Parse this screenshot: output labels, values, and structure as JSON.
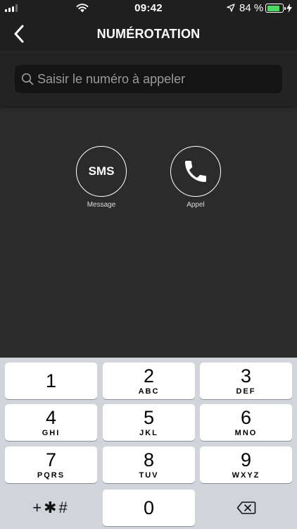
{
  "status_bar": {
    "time": "09:42",
    "battery_percent": "84 %",
    "battery_level": 0.84,
    "icons": [
      "signal-icon",
      "wifi-icon",
      "location-arrow-icon",
      "battery-icon",
      "charging-bolt-icon"
    ]
  },
  "nav": {
    "title": "NUMÉROTATION",
    "back_icon": "chevron-left-icon"
  },
  "search": {
    "placeholder": "Saisir le numéro à appeler",
    "value": "",
    "icon": "search-icon"
  },
  "actions": {
    "sms": {
      "text": "SMS",
      "label": "Message"
    },
    "call": {
      "icon": "phone-icon",
      "label": "Appel"
    }
  },
  "keypad": {
    "keys": [
      {
        "digit": "1",
        "letters": ""
      },
      {
        "digit": "2",
        "letters": "ABC"
      },
      {
        "digit": "3",
        "letters": "DEF"
      },
      {
        "digit": "4",
        "letters": "GHI"
      },
      {
        "digit": "5",
        "letters": "JKL"
      },
      {
        "digit": "6",
        "letters": "MNO"
      },
      {
        "digit": "7",
        "letters": "PQRS"
      },
      {
        "digit": "8",
        "letters": "TUV"
      },
      {
        "digit": "9",
        "letters": "WXYZ"
      },
      {
        "digit": "0",
        "letters": ""
      }
    ],
    "symbols_label": "+✱#",
    "delete_icon": "backspace-icon"
  },
  "colors": {
    "background": "#2b2b2b",
    "bar": "#1f1f1f",
    "keypad_bg": "#d1d4da",
    "battery_green": "#4cd964"
  }
}
